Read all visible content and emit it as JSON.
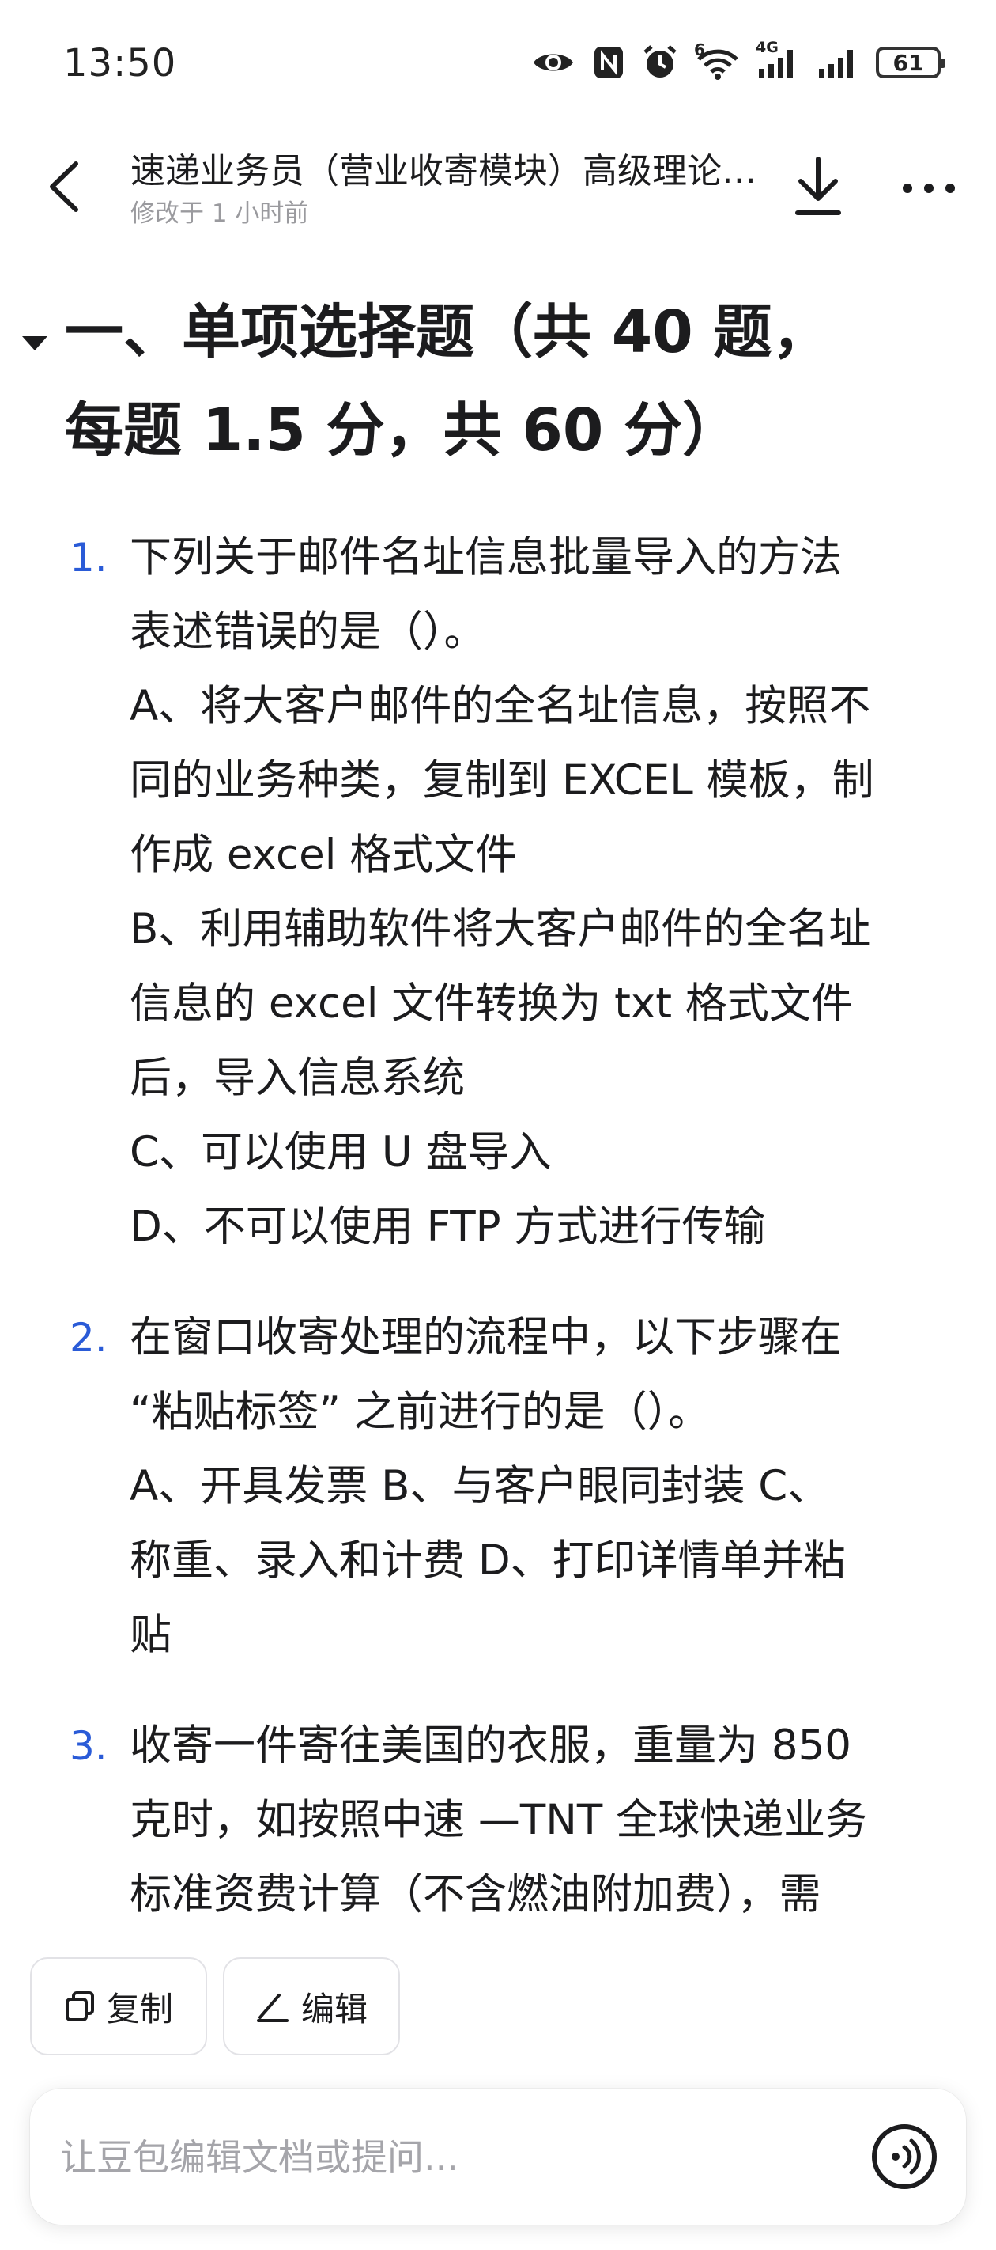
{
  "status_bar": {
    "time": "13:50",
    "battery": "61",
    "icons": [
      "eye-icon",
      "nfc-icon",
      "alarm-icon",
      "wifi-6-icon",
      "signal-4g-icon",
      "signal-icon",
      "battery-icon"
    ],
    "wifi_badge": "6",
    "network_badge": "4G"
  },
  "header": {
    "title": "速递业务员（营业收寄模块）高级理论知识试卷",
    "subtitle": "修改于 1 小时前",
    "icons": [
      "back-icon",
      "download-icon",
      "more-icon"
    ]
  },
  "heading": {
    "line1": "一、单项选择题（共 40 题，",
    "line2": "每题 1.5 分，共 60 分）"
  },
  "questions": [
    {
      "number": "1.",
      "lines": [
        "下列关于邮件名址信息批量导入的方法",
        "表述错误的是（）。",
        "A、将大客户邮件的全名址信息，按照不",
        "同的业务种类，复制到 EXCEL 模板，制",
        "作成 excel 格式文件",
        "B、利用辅助软件将大客户邮件的全名址",
        "信息的 excel 文件转换为 txt 格式文件",
        "后，导入信息系统",
        "C、可以使用 U 盘导入",
        "D、不可以使用 FTP 方式进行传输"
      ]
    },
    {
      "number": "2.",
      "lines": [
        "在窗口收寄处理的流程中，以下步骤在",
        "“粘贴标签” 之前进行的是（）。",
        "A、开具发票  B、与客户眼同封装  C、",
        "称重、录入和计费  D、打印详情单并粘",
        "贴"
      ]
    },
    {
      "number": "3.",
      "lines": [
        "收寄一件寄往美国的衣服，重量为 850",
        "克时，如按照中速 —TNT 全球快递业务",
        "标准资费计算（不含燃油附加费），需"
      ]
    }
  ],
  "actions": {
    "copy_label": "复制",
    "edit_label": "编辑"
  },
  "input": {
    "placeholder": "让豆包编辑文档或提问..."
  }
}
